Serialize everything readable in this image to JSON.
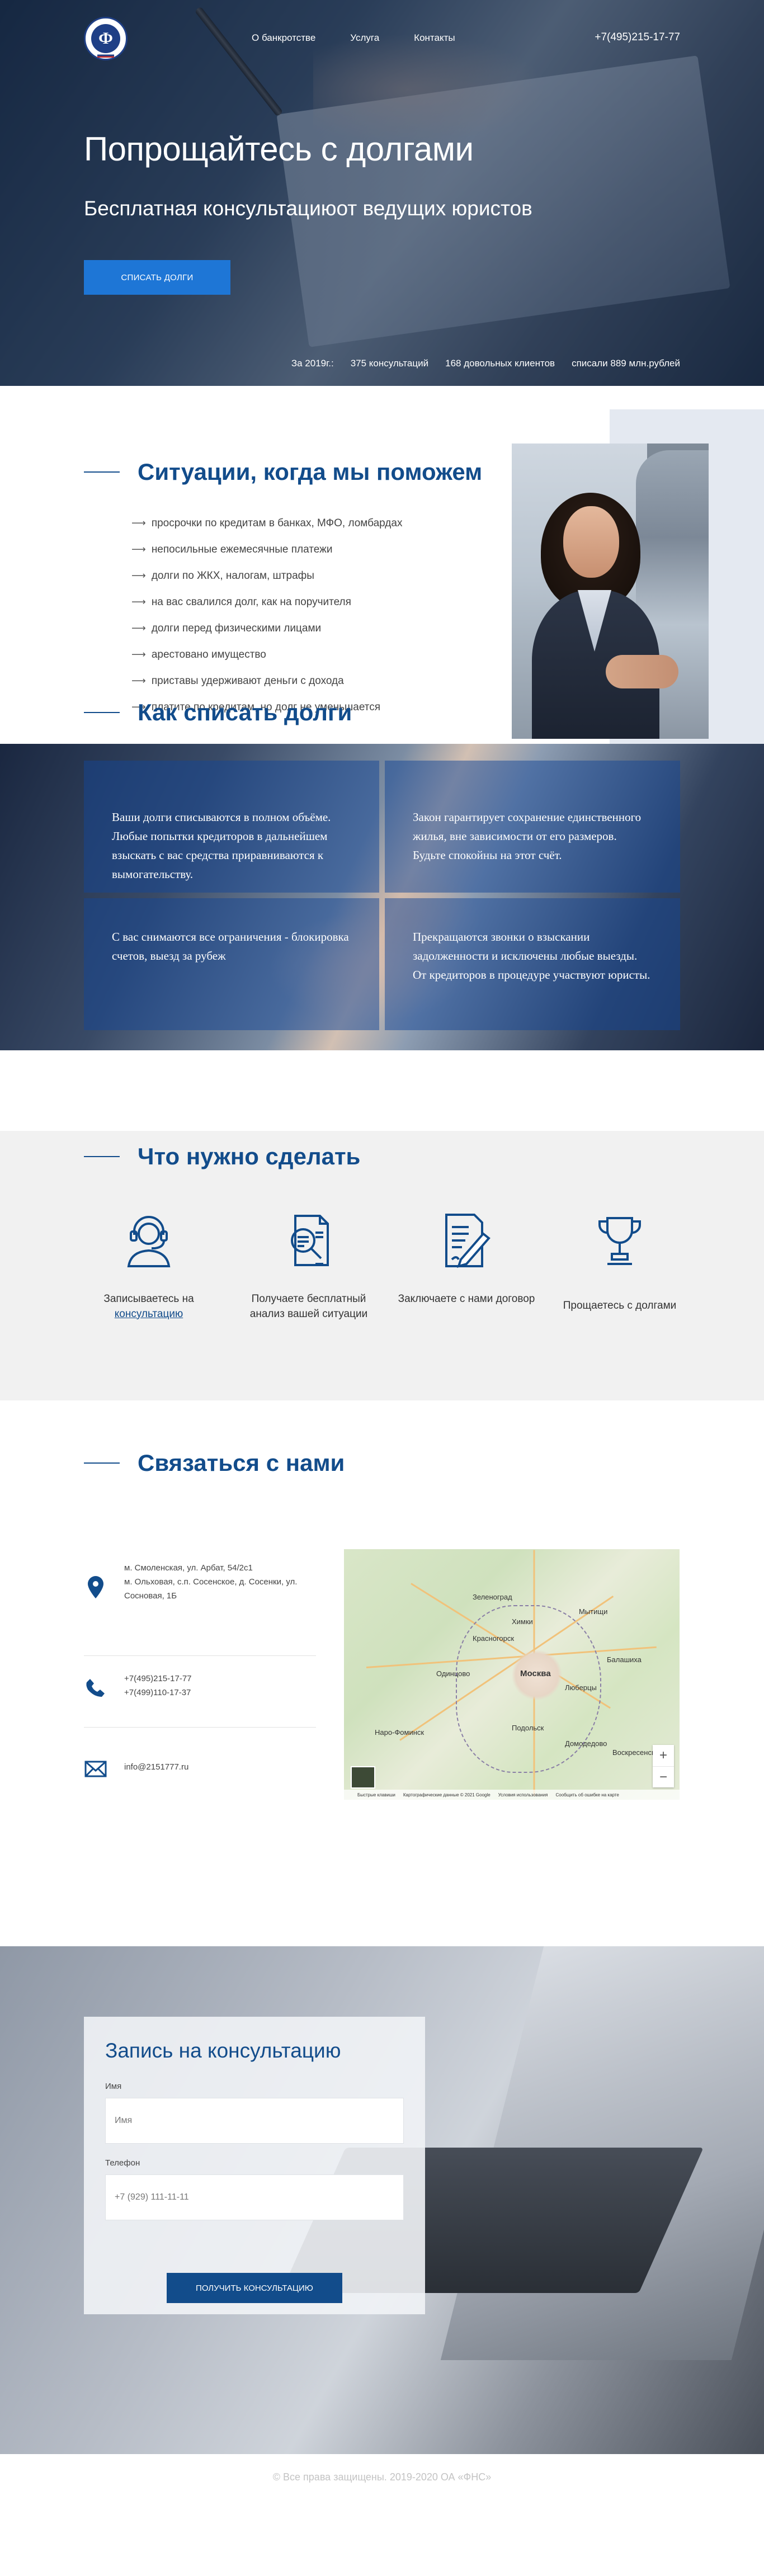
{
  "header": {
    "menu": [
      "О банкротстве",
      "Услуга",
      "Контакты"
    ],
    "phone": "+7(495)215-17-77"
  },
  "hero": {
    "title": "Попрощайтесь с долгами",
    "subtitle": "Бесплатная консультациюот ведущих юристов",
    "cta": "СПИСАТЬ ДОЛГИ",
    "stats": [
      "За 2019г.:",
      "375 консультаций",
      "168 довольных клиентов",
      "списали 889 млн.рублей"
    ]
  },
  "situations": {
    "title": "Ситуации, когда мы поможем",
    "items": [
      "просрочки по кредитам в банках, МФО, ломбардах",
      "непосильные ежемесячные платежи",
      "долги по ЖКХ, налогам, штрафы",
      "на вас свалился долг, как на поручителя",
      "долги перед физическими лицами",
      "арестовано имущество",
      "приставы удерживают деньги с дохода",
      "платите по кредитам, но долг не уменьшается"
    ]
  },
  "howto": {
    "title": "Как списать долги"
  },
  "benefits": [
    "Ваши долги списываются в полном объёме. Любые попытки кредиторов в дальнейшем взыскать с вас средства приравниваются к вымогательству.",
    "Закон гарантирует сохранение единственного жилья, вне зависимости от его размеров. Будьте спокойны на этот счёт.",
    "С вас снимаются все ограничения - блокировка счетов, выезд за рубеж",
    "Прекращаются звонки о взыскании задолженности и исключены любые выезды. От кредиторов в процедуре участвуют юристы."
  ],
  "steps": {
    "title": "Что нужно сделать",
    "items": [
      {
        "text": "Записываетесь на",
        "link": "консультацию",
        "icon": "operator-headset-icon"
      },
      {
        "text": "Получаете бесплатный анализ вашей ситуации",
        "icon": "document-search-icon"
      },
      {
        "text": "Заключаете с нами договор",
        "icon": "contract-sign-icon"
      },
      {
        "text": "Прощаетесь с долгами",
        "icon": "trophy-icon"
      }
    ]
  },
  "contacts": {
    "title": "Связаться с нами",
    "address1": "м. Смоленская, ул. Арбат, 54/2с1",
    "address2": "м. Ольховая, с.п. Сосенское, д. Сосенки, ул. Сосновая, 1Б",
    "phone1": "+7(495)215-17-77",
    "phone2": "+7(499)110-17-37",
    "email": "info@2151777.ru"
  },
  "map": {
    "labels": [
      "Зеленоград",
      "Химки",
      "Мытищи",
      "Красногорск",
      "Москва",
      "Люберцы",
      "Одинцово",
      "Балашиха",
      "Подольск",
      "Наро-Фоминск",
      "Домодедово",
      "Воскресенск"
    ],
    "credits": [
      "Быстрые клавиши",
      "Картографические данные © 2021 Google",
      "Условия использования",
      "Сообщить об ошибке на карте"
    ]
  },
  "form": {
    "title": "Запись на консультацию",
    "name_label": "Имя",
    "name_placeholder": "Имя",
    "phone_label": "Телефон",
    "phone_placeholder": "+7 (929) 111-11-11",
    "submit": "ПОЛУЧИТЬ КОНСУЛЬТАЦИЮ"
  },
  "footer": {
    "copyright": "© Все права защищены. 2019-2020 ОА «ФНС»"
  },
  "colors": {
    "brand": "#124c8b",
    "accent_button": "#1e76d6",
    "steps_bg": "#f1f1f1"
  }
}
